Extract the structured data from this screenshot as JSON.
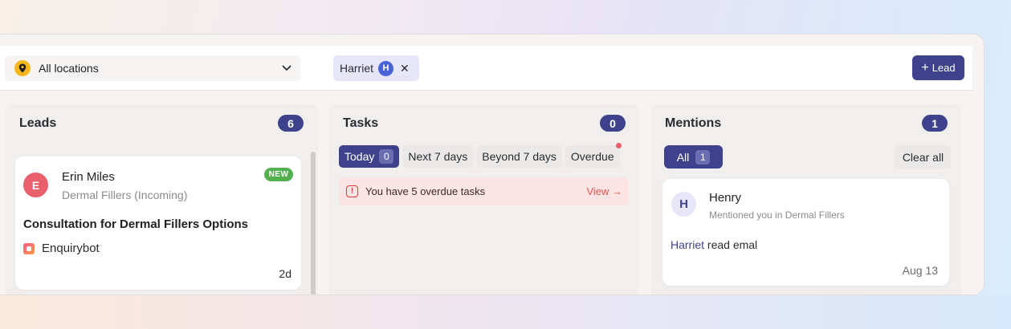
{
  "topbar": {
    "location_select": {
      "value": "All locations",
      "icon": "location-pin-icon"
    },
    "filter_chip": {
      "label": "Harriet",
      "avatar_initial": "H"
    },
    "add_lead_button": {
      "label": "Lead",
      "icon": "plus"
    }
  },
  "columns": {
    "leads": {
      "title": "Leads",
      "count": "6",
      "cards": [
        {
          "avatar_initial": "E",
          "name": "Erin Miles",
          "subtitle": "Dermal Fillers (Incoming)",
          "badge": "NEW",
          "title": "Consultation for Dermal Fillers Options",
          "source": "Enquirybot",
          "age": "2d"
        }
      ]
    },
    "tasks": {
      "title": "Tasks",
      "count": "0",
      "tabs": [
        {
          "label": "Today",
          "count": "0",
          "active": true
        },
        {
          "label": "Next 7 days"
        },
        {
          "label": "Beyond 7 days"
        },
        {
          "label": "Overdue",
          "indicator": true
        }
      ],
      "banner": {
        "text": "You have 5 overdue tasks",
        "link": "View →"
      }
    },
    "mentions": {
      "title": "Mentions",
      "count": "1",
      "filter": {
        "label": "All",
        "count": "1"
      },
      "clear_label": "Clear all",
      "cards": [
        {
          "avatar_initial": "H",
          "name": "Henry",
          "subtitle": "Mentioned you in Dermal Fillers",
          "message_who": "Harriet",
          "message_text": " read emal",
          "date": "Aug 13"
        }
      ]
    }
  },
  "colors": {
    "primary": "#3e428c",
    "new_badge": "#52b04f",
    "lead_avatar": "#e8606c",
    "warning": "#e03a3e",
    "banner_bg": "#fde4e4",
    "pin": "#f5b71a"
  }
}
